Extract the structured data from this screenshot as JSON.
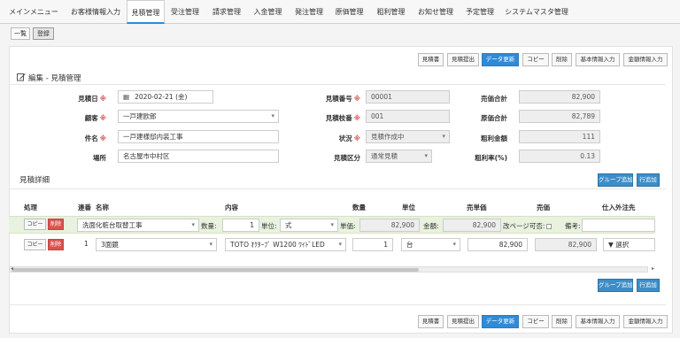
{
  "nav": {
    "items": [
      "メインメニュー",
      "お客様情報入力",
      "見積管理",
      "受注管理",
      "請求管理",
      "入金管理",
      "発注管理",
      "原価管理",
      "粗利管理",
      "お知せ管理",
      "予定管理",
      "システムマスタ管理"
    ],
    "active_index": 2
  },
  "subtabs": {
    "list": "一覧",
    "register": "登録"
  },
  "actions": {
    "estimate": "見積書",
    "submit": "見積提出",
    "update": "データ更新",
    "copy": "コピー",
    "delete": "削除",
    "basic_info": "基本情報入力",
    "amount_info": "金額情報入力"
  },
  "form": {
    "title": "編集 - 見積管理",
    "labels": {
      "estimate_date": "見積日",
      "customer": "顧客",
      "subject": "件名",
      "place": "場所",
      "estimate_no": "見積番号",
      "estimate_count": "見積枝番",
      "status": "状況",
      "estimate_type": "見積区分",
      "sales_total": "売価合計",
      "cost_total": "原価合計",
      "profit": "粗利金額",
      "profit_rate": "粗利率(%)"
    },
    "required_mark": "※",
    "values": {
      "estimate_date": "2020-02-21 (金)",
      "customer": "一戸建欧郎",
      "subject": "一戸建様邸内装工事",
      "place": "名古屋市中村区",
      "estimate_no": "00001",
      "estimate_count": "001",
      "status": "見積作成中",
      "estimate_type": "通常見積",
      "sales_total": "82,900",
      "cost_total": "82,789",
      "profit": "111",
      "profit_rate": "0.13"
    }
  },
  "detail": {
    "title": "見積詳細",
    "group_add": "グループ追加",
    "row_add": "行追加",
    "headers": {
      "process": "処理",
      "line_no": "連番",
      "name": "名称",
      "content": "内容",
      "qty": "数量",
      "unit": "単位",
      "unit_price": "売単価",
      "price": "売価",
      "supplier": "仕入外注先"
    },
    "group_row": {
      "copy": "コピー",
      "delete": "削除",
      "name": "洗面化粧台取替工事",
      "qty_label": "数量:",
      "qty": "1",
      "unit_label": "単位:",
      "unit": "式",
      "unit_price_label": "単価:",
      "unit_price": "82,900",
      "amount_label": "金額:",
      "amount": "82,900",
      "page_break_label": "改ページ可否:",
      "memo_label": "備考:"
    },
    "item_row": {
      "copy": "コピー",
      "delete": "削除",
      "line_no": "1",
      "name": "3面鏡",
      "content": "TOTO ｵｸﾀｰﾌﾞ W1200 ﾜｲﾄﾞLED",
      "qty": "1",
      "unit": "台",
      "unit_price": "82,900",
      "price": "82,900",
      "supplier": "▼ 選択"
    }
  }
}
